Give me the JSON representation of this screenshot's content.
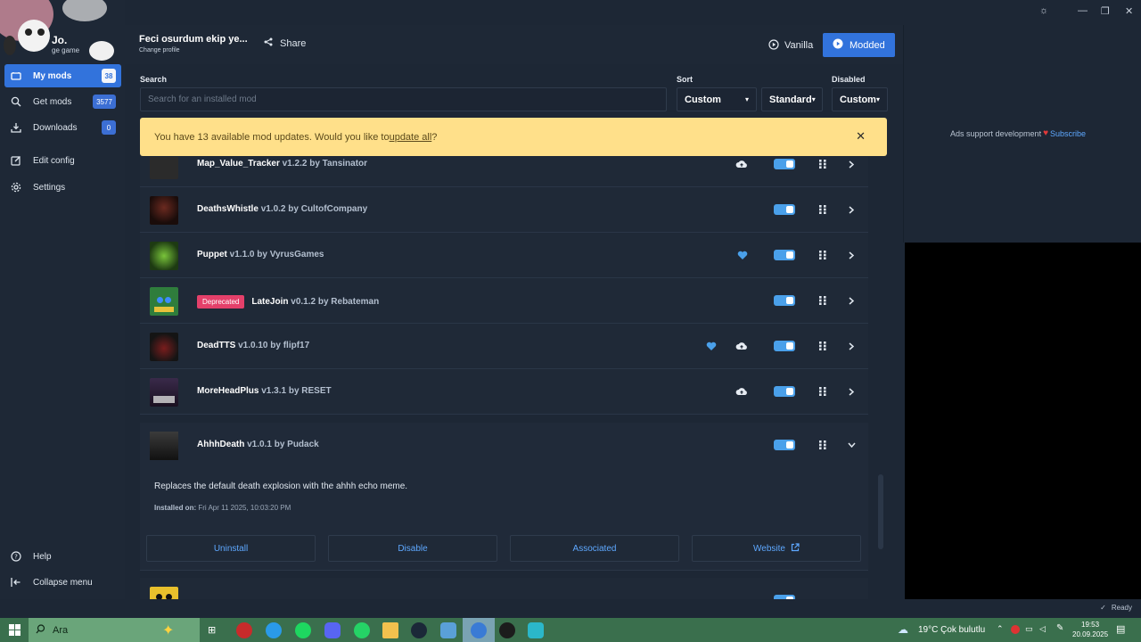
{
  "profile": {
    "name": "Jo.",
    "sub": "ge game",
    "title": "Feci osurdum ekip ye...",
    "change": "Change profile"
  },
  "sidebar": {
    "items": [
      {
        "label": "My mods",
        "badge": "38"
      },
      {
        "label": "Get mods",
        "badge": "3577"
      },
      {
        "label": "Downloads",
        "badge": "0"
      },
      {
        "label": "Edit config"
      },
      {
        "label": "Settings"
      }
    ],
    "help": "Help",
    "collapse": "Collapse menu"
  },
  "topbar": {
    "share": "Share",
    "vanilla": "Vanilla",
    "modded": "Modded"
  },
  "filters": {
    "search_label": "Search",
    "search_placeholder": "Search for an installed mod",
    "sort_label": "Sort",
    "sort_value": "Custom",
    "sort_dir": "Standard",
    "disabled_label": "Disabled",
    "disabled_value": "Custom"
  },
  "banner": {
    "text": "You have 13 available mod updates. Would you like to ",
    "link": "update all",
    "end": "?"
  },
  "mods": [
    {
      "name": "Map_Value_Tracker",
      "meta": "v1.2.2 by Tansinator"
    },
    {
      "name": "DeathsWhistle",
      "meta": "v1.0.2 by CultofCompany"
    },
    {
      "name": "Puppet",
      "meta": "v1.1.0 by VyrusGames"
    },
    {
      "name": "LateJoin",
      "meta": "v0.1.2 by Rebateman",
      "tag": "Deprecated"
    },
    {
      "name": "DeadTTS",
      "meta": "v1.0.10 by flipf17"
    },
    {
      "name": "MoreHeadPlus",
      "meta": "v1.3.1 by RESET"
    },
    {
      "name": "AhhhDeath",
      "meta": "v1.0.1 by Pudack"
    }
  ],
  "expanded": {
    "description": "Replaces the default death explosion with the ahhh echo meme.",
    "installed_label": "Installed on:",
    "installed_value": "Fri Apr 11 2025, 10:03:20 PM",
    "actions": [
      "Uninstall",
      "Disable",
      "Associated",
      "Website"
    ]
  },
  "ads": {
    "text": "Ads support development",
    "subscribe": "Subscribe"
  },
  "status": {
    "ready": "Ready"
  },
  "taskbar": {
    "search": "Ara",
    "weather": "19°C  Çok bulutlu",
    "time": "19:53",
    "date": "20.09.2025"
  },
  "colors": {
    "accent": "#3273dc",
    "banner": "#ffe08a",
    "deprecated": "#e4406a",
    "toggle": "#4aa0ea"
  }
}
